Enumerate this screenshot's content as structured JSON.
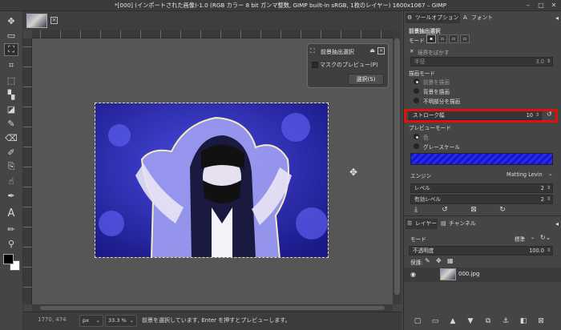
{
  "window": {
    "title": "*[000] (インポートされた画像)-1.0 (RGB カラー 8 bit ガンマ整数, GIMP built-in sRGB, 1枚のレイヤー) 1600x1067 – GIMP"
  },
  "floating_dialog": {
    "title": "前景抽出選択",
    "checkbox_label": "マスクのプレビュー(P)",
    "select_button": "選択(S)"
  },
  "statusbar": {
    "coords": "1770, 474",
    "units": "px",
    "zoom": "33.3 %",
    "message": "前景を選択しています, Enter を押すとプレビューします。"
  },
  "dock": {
    "tabs": [
      "ツールオプション",
      "フォント"
    ],
    "tool_title": "前景抽出選択",
    "mode_label": "モード",
    "feather_label": "境界をぼかす",
    "radius_label": "半径",
    "radius_value": "3.0",
    "draw_mode_label": "描画モード",
    "draw_options": [
      "前景を描画",
      "背景を描画",
      "不明部分を描画"
    ],
    "stroke_label": "ストローク幅",
    "stroke_value": "10",
    "preview_mode_label": "プレビューモード",
    "preview_options": [
      "色",
      "グレースケール"
    ],
    "engine_label": "エンジン",
    "engine_value": "Matting Levin",
    "level_label": "レベル",
    "level_value": "2",
    "active_level_label": "有効レベル",
    "active_level_value": "2",
    "layer_tabs": [
      "レイヤー",
      "チャンネル"
    ],
    "layer_mode_label": "モード",
    "layer_mode_value": "標準",
    "opacity_label": "不透明度",
    "opacity_value": "100.0",
    "lock_label": "保護:",
    "layer_name": "000.jpg"
  },
  "colors": {
    "highlight": "#e01010",
    "preview_blue": "#2020d8"
  }
}
